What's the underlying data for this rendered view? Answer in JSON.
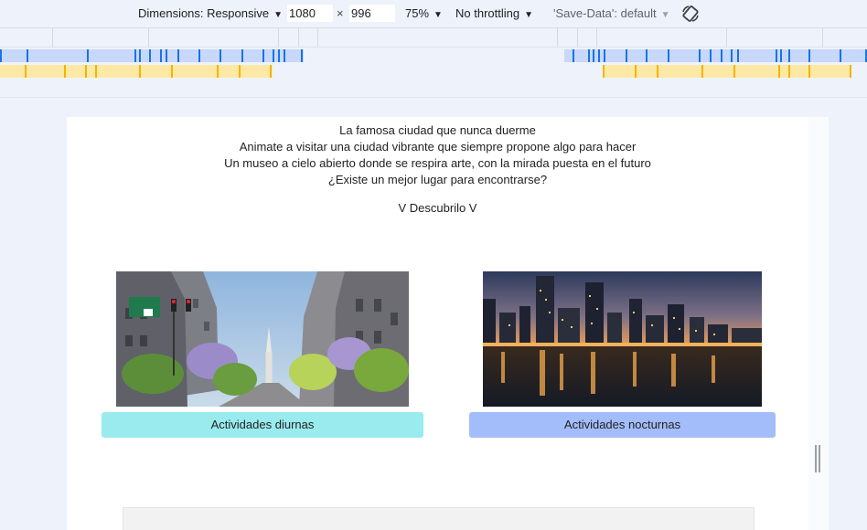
{
  "toolbar": {
    "dimensions_label": "Dimensions: Responsive",
    "width_value": "1080",
    "times": "×",
    "height_value": "996",
    "zoom": "75%",
    "throttling": "No throttling",
    "save_data": "'Save-Data': default",
    "rotate_icon": "rotate-icon",
    "caret": "▼"
  },
  "page": {
    "intro_lines": [
      "La famosa ciudad que nunca duerme",
      "Animate a visitar una ciudad vibrante que siempre propone algo para hacer",
      "Un museo a cielo abierto donde se respira arte, con la mirada puesta en el futuro",
      "¿Existe un mejor lugar para encontrarse?"
    ],
    "discover": "V Descubrilo V",
    "day_button": "Actividades diurnas",
    "night_button": "Actividades nocturnas"
  },
  "colors": {
    "day_button": "#99ebee",
    "night_button": "#a3bdfa",
    "media_query_blue": "#1a73e8",
    "media_query_yellow": "#f2b400"
  }
}
